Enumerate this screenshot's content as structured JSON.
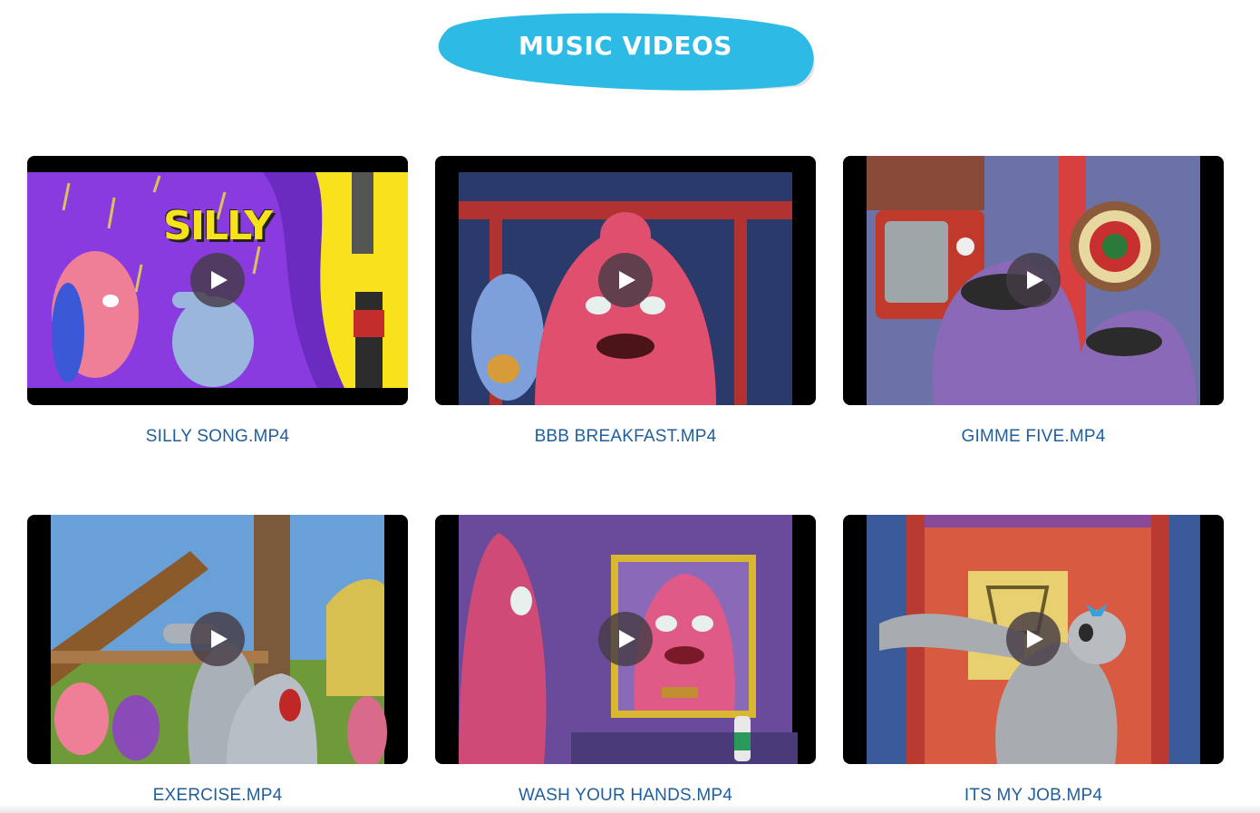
{
  "header": {
    "title": "MUSIC VIDEOS",
    "accent": "#2dbbe5"
  },
  "videos": [
    {
      "label": "SILLY SONG.MP4",
      "thumb_text": "SILLY"
    },
    {
      "label": "BBB BREAKFAST.MP4"
    },
    {
      "label": "GIMME FIVE.MP4"
    },
    {
      "label": "EXERCISE.MP4"
    },
    {
      "label": "WASH YOUR HANDS.MP4"
    },
    {
      "label": "ITS MY JOB.MP4"
    }
  ],
  "icons": {
    "play": "play-icon"
  },
  "colors": {
    "caption": "#1f5e9e",
    "play_button": "#4a3f48"
  }
}
